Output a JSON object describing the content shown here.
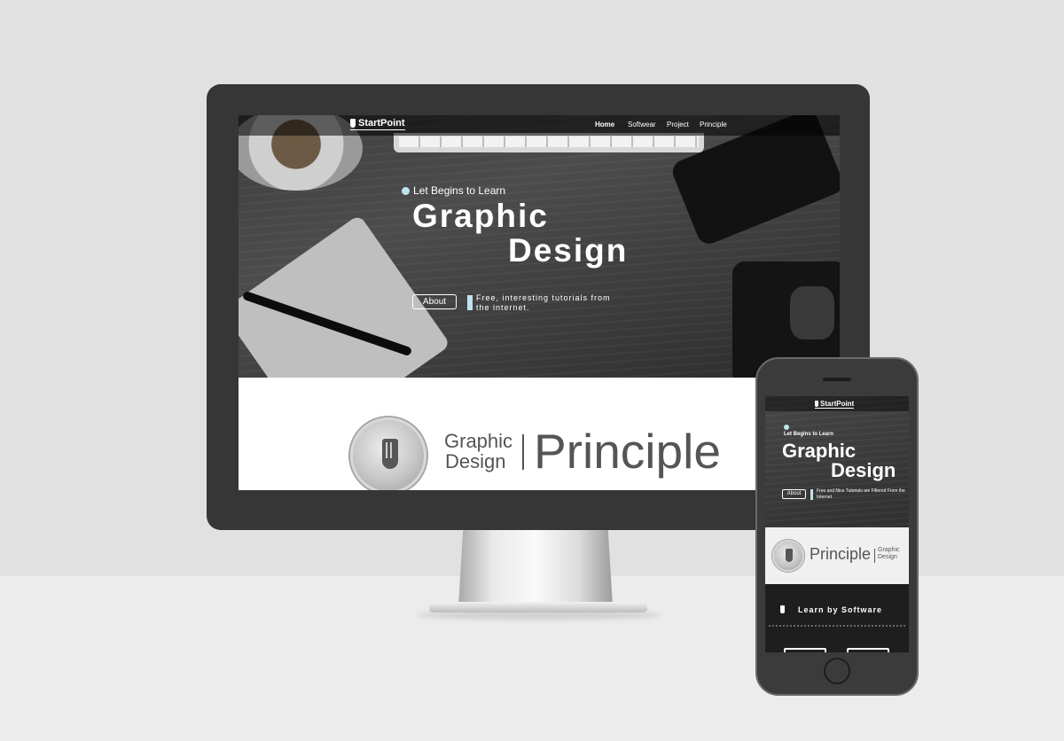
{
  "desktop": {
    "brand": "StartPoint",
    "nav": [
      "Home",
      "Softwear",
      "Project",
      "Principle"
    ],
    "hero": {
      "kicker": "Let Begins to Learn",
      "title_line1": "Graphic",
      "title_line2": "Design",
      "about_button": "About",
      "tagline": "Free, interesting tutorials from the internet."
    },
    "principle_band": {
      "line1": "Graphic",
      "line2": "Design",
      "word": "Principle"
    }
  },
  "mobile": {
    "brand": "StartPoint",
    "hero": {
      "kicker": "Let Begins to Learn",
      "title_line1": "Graphic",
      "title_line2": "Design",
      "about_button": "About",
      "tagline": "Free and Nice Tutorials are Filtered From the Internet."
    },
    "principle_band": {
      "word": "Principle",
      "line1": "Graphic",
      "line2": "Design"
    },
    "software_section": {
      "title": "Learn by Software"
    }
  },
  "colors": {
    "accent": "#bfe3ee",
    "bezel": "#363636",
    "text_gray": "#555555"
  },
  "icons": [
    "pencil-logo-icon",
    "pencil-badge-icon",
    "home-button-icon"
  ]
}
